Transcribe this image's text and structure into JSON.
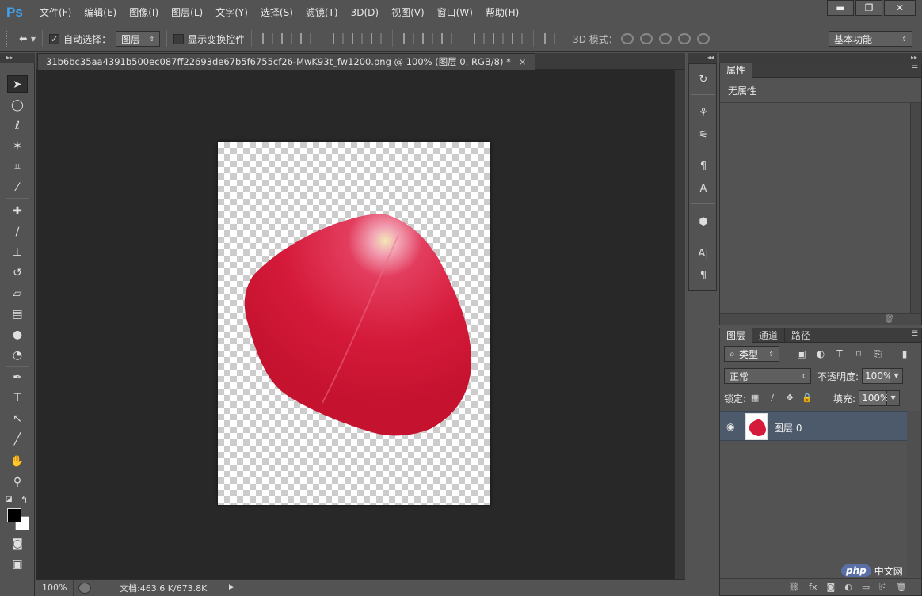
{
  "app": {
    "logo": "Ps",
    "menus": [
      "文件(F)",
      "编辑(E)",
      "图像(I)",
      "图层(L)",
      "文字(Y)",
      "选择(S)",
      "滤镜(T)",
      "3D(D)",
      "视图(V)",
      "窗口(W)",
      "帮助(H)"
    ],
    "window_controls": {
      "minimize": "▬",
      "maximize": "❐",
      "close": "✕"
    }
  },
  "options": {
    "auto_select_label": "自动选择：",
    "auto_select_checked": "✓",
    "auto_select_target": "图层",
    "show_transform_label": "显示变换控件",
    "mode3d_label": "3D 模式：",
    "workspace": "基本功能"
  },
  "document": {
    "tab_title": "31b6bc35aa4391b500ec087ff22693de67b5f6755cf26-MwK93t_fw1200.png @ 100% (图层 0, RGB/8) *",
    "close": "×",
    "petal_color": "#d51a3a"
  },
  "status": {
    "zoom": "100%",
    "doc_size": "文档:463.6 K/673.8K",
    "arrow": "▶"
  },
  "properties": {
    "tab": "属性",
    "empty": "无属性"
  },
  "layers": {
    "tabs": [
      "图层",
      "通道",
      "路径"
    ],
    "filter_type": "类型",
    "blend_mode": "正常",
    "opacity_label": "不透明度:",
    "opacity_value": "100%",
    "lock_label": "锁定:",
    "fill_label": "填充:",
    "fill_value": "100%",
    "items": [
      {
        "name": "图层 0",
        "visible": true,
        "selected": true
      }
    ]
  },
  "watermark": {
    "logo": "php",
    "text": "中文网"
  }
}
